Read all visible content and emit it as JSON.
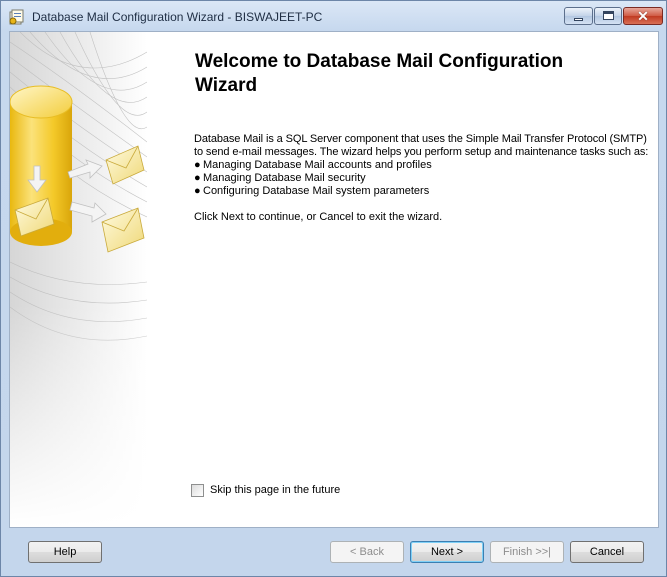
{
  "window": {
    "title": "Database Mail Configuration Wizard - BISWAJEET-PC",
    "controls": {
      "close_glyph": "✕"
    }
  },
  "page": {
    "heading": "Welcome to Database Mail Configuration Wizard",
    "description": "Database Mail is a SQL Server component that uses the Simple Mail Transfer Protocol (SMTP) to send e-mail messages. The wizard helps you perform setup and maintenance tasks such as:",
    "bullet_glyph": "●",
    "bullets": [
      "Managing Database Mail accounts and profiles",
      "Managing Database Mail security",
      "Configuring Database Mail system parameters"
    ],
    "hint": "Click Next to continue, or Cancel to exit the wizard.",
    "skip_checkbox": {
      "label": "Skip this page in the future",
      "checked": false
    }
  },
  "buttons": {
    "help": "Help",
    "back": "< Back",
    "next": "Next >",
    "finish": "Finish >>|",
    "cancel": "Cancel"
  },
  "colors": {
    "title_text": "#1e2d43",
    "frame": "#c4d6ec",
    "database_gold": "#f2c21b",
    "envelope": "#f4e7a0",
    "close_red": "#c03a22"
  }
}
